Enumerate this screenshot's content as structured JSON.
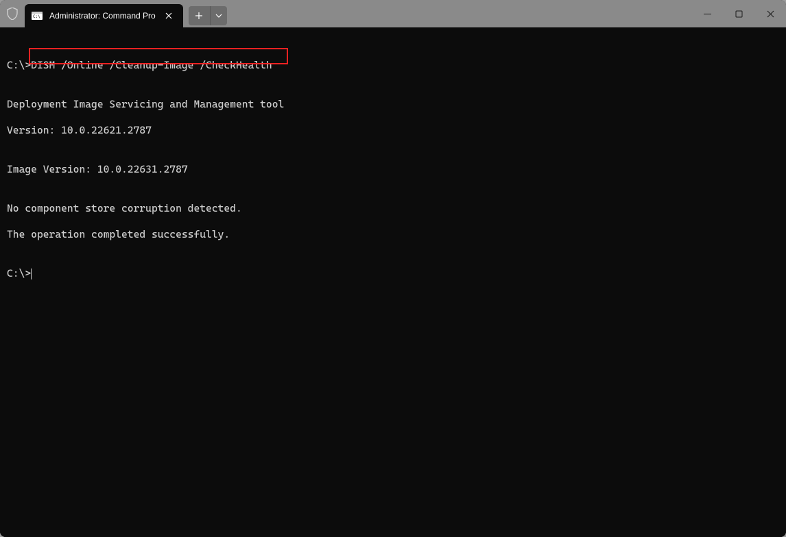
{
  "tab": {
    "title": "Administrator: Command Pro"
  },
  "terminal": {
    "lines": [
      "",
      "C:\\>DISM /Online /Cleanup-Image /CheckHealth",
      "",
      "Deployment Image Servicing and Management tool",
      "Version: 10.0.22621.2787",
      "",
      "Image Version: 10.0.22631.2787",
      "",
      "No component store corruption detected.",
      "The operation completed successfully.",
      "",
      "C:\\>"
    ],
    "highlighted_command": "DISM /Online /Cleanup-Image /CheckHealth"
  }
}
